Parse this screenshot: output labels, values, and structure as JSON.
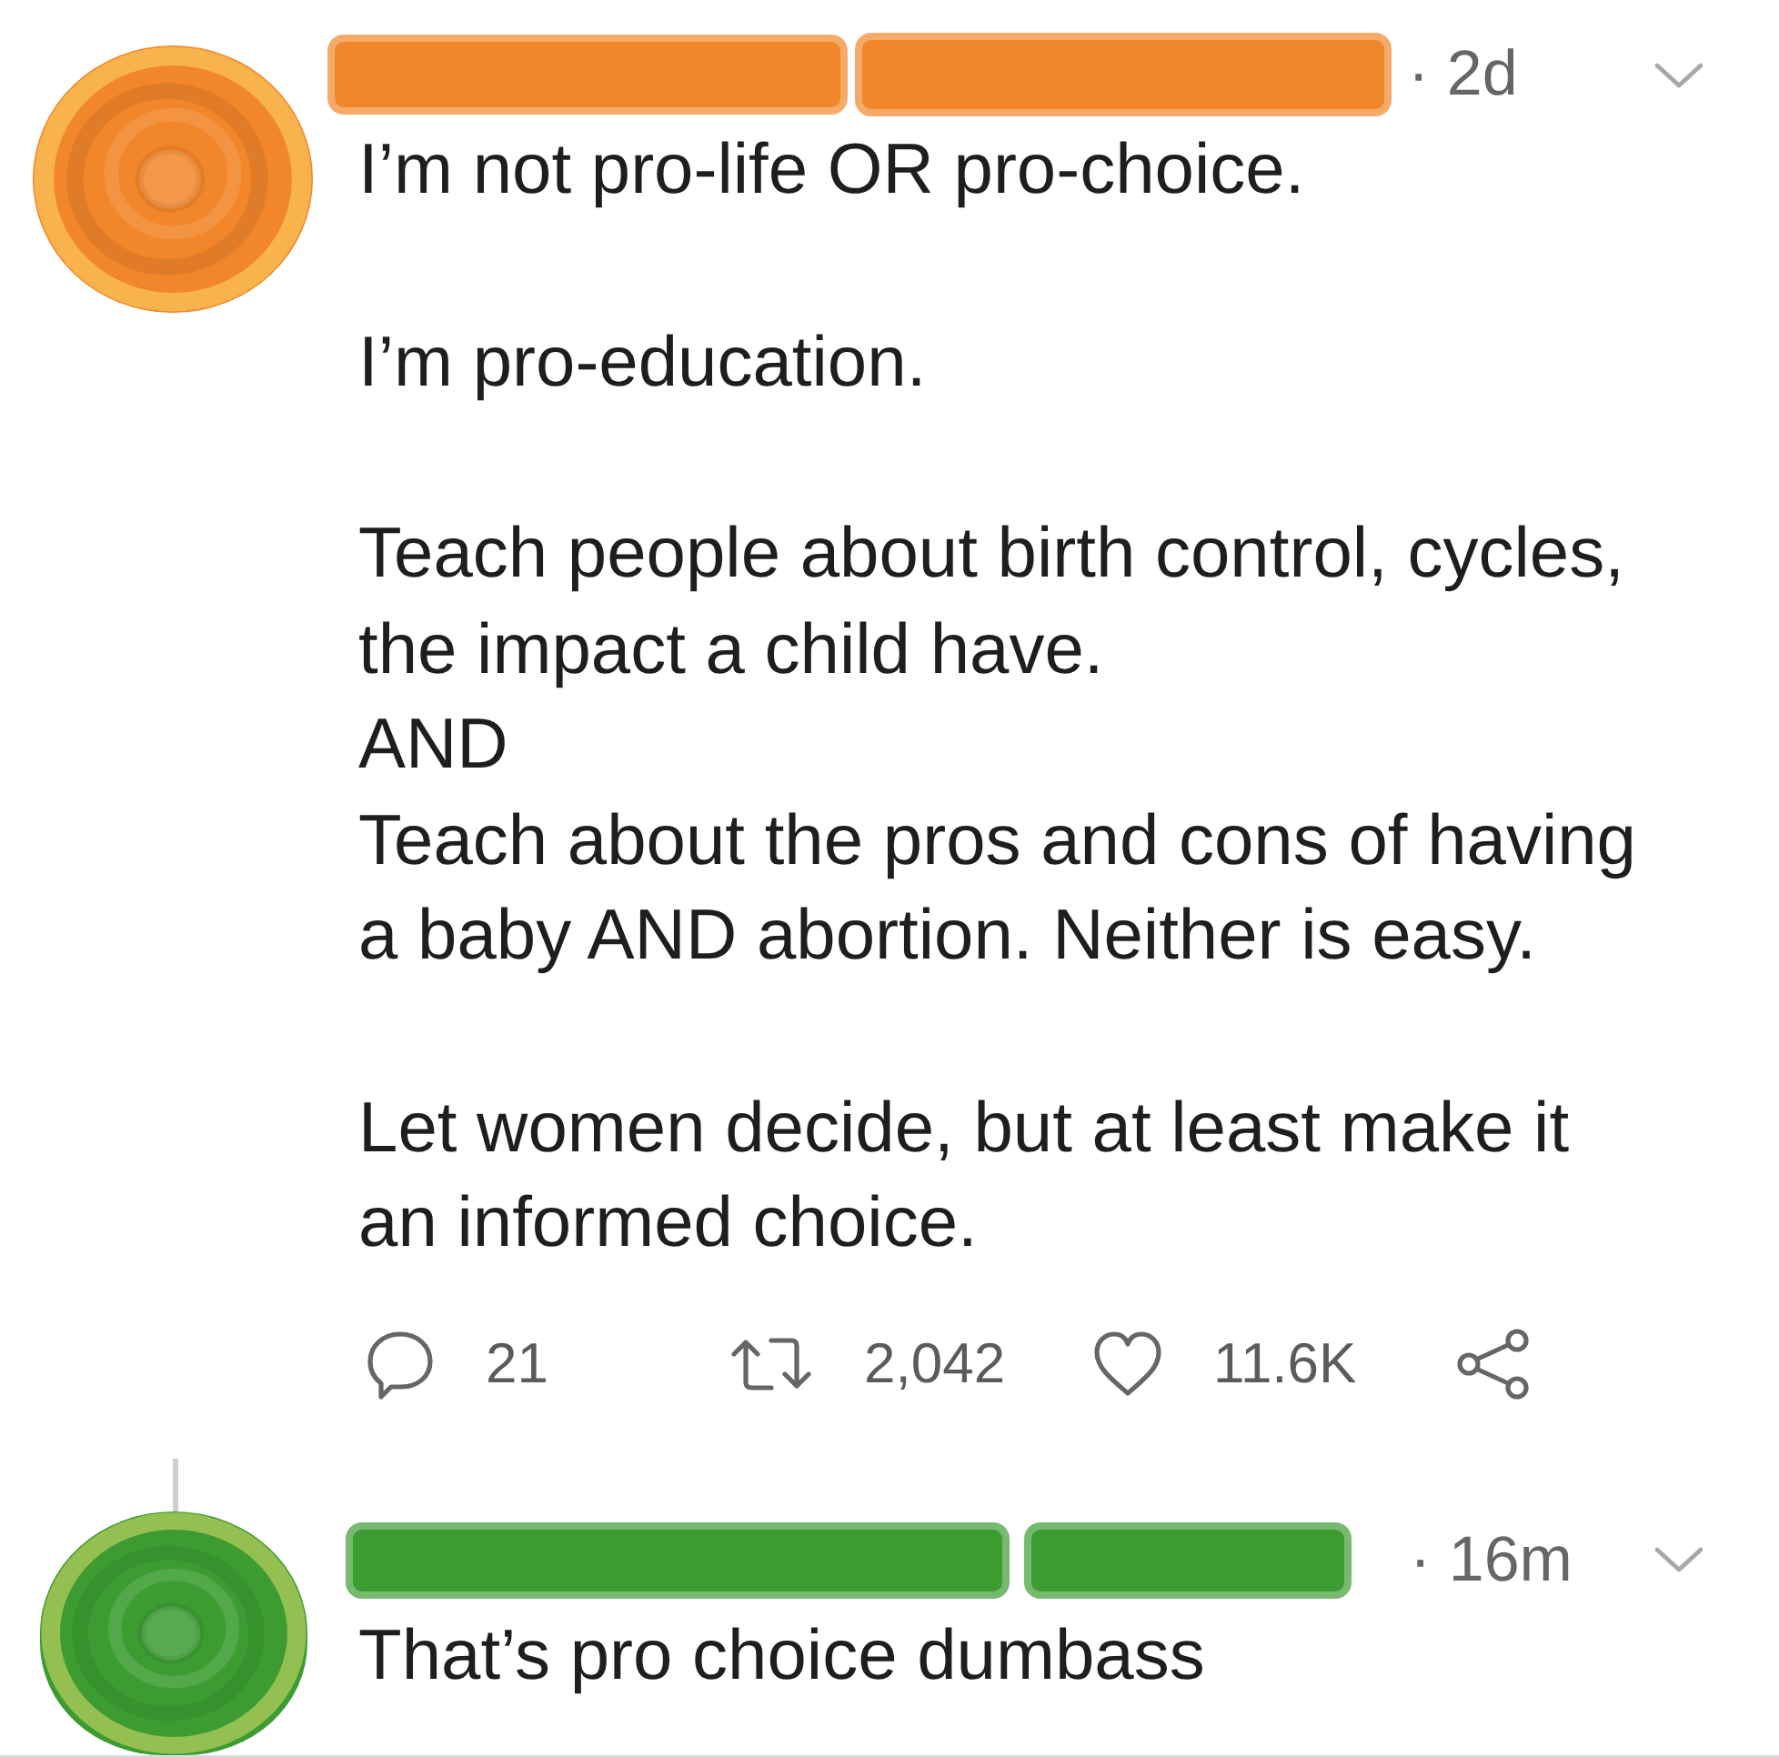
{
  "tweets": [
    {
      "color": "#f2862a",
      "time": "· 2d",
      "paragraphs": [
        [
          "I’m not pro-life OR pro-choice."
        ],
        [
          "I’m pro-education."
        ],
        [
          "Teach people about birth control, cycles,",
          "the impact a child have.",
          "AND",
          "Teach about the pros and cons of having",
          "a baby AND abortion. Neither is easy."
        ],
        [
          "Let women decide, but at least make it",
          "an informed choice."
        ]
      ],
      "actions": [
        {
          "kind": "reply",
          "count": "21"
        },
        {
          "kind": "retweet",
          "count": "2,042"
        },
        {
          "kind": "like",
          "count": "11.6K"
        },
        {
          "kind": "share"
        }
      ]
    },
    {
      "color": "#3c9c32",
      "time": "· 16m",
      "paragraphs": [
        [
          "That’s pro choice dumbass"
        ]
      ]
    }
  ]
}
